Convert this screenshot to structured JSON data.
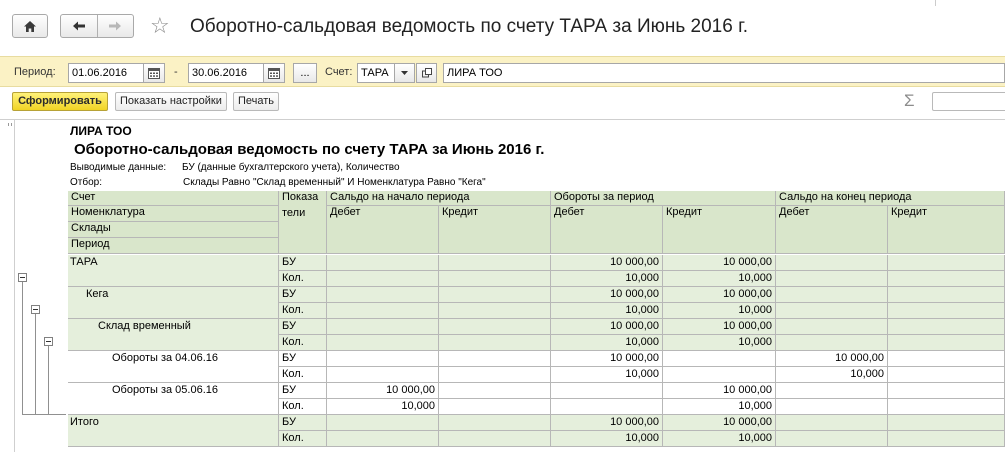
{
  "window": {
    "title": "Оборотно-сальдовая ведомость по счету ТАРА  за Июнь 2016 г."
  },
  "params": {
    "period_label": "Период:",
    "date_from": "01.06.2016",
    "dash": "-",
    "date_to": "30.06.2016",
    "more_button": "...",
    "account_label": "Счет:",
    "account_value": "ТАРА",
    "org_value": "ЛИРА ТОО"
  },
  "commands": {
    "generate": "Сформировать",
    "show_settings": "Показать настройки",
    "print": "Печать",
    "sigma": "Σ"
  },
  "report": {
    "org": "ЛИРА ТОО",
    "title": "Оборотно-сальдовая ведомость по счету ТАРА  за Июнь 2016 г.",
    "output_label": "Выводимые данные:",
    "output_value": "БУ (данные бухгалтерского учета), Количество",
    "filter_label": "Отбор:",
    "filter_value": "Склады Равно \"Склад временный\" И Номенклатура Равно \"Кега\"",
    "headers": {
      "account": "Счет",
      "nomenclature": "Номенклатура",
      "warehouses": "Склады",
      "period": "Период",
      "indicators_1": "Показа",
      "indicators_2": "тели",
      "opening": "Сальдо на начало периода",
      "turnover": "Обороты за период",
      "closing": "Сальдо на конец периода",
      "debit": "Дебет",
      "credit": "Кредит"
    },
    "rows": [
      {
        "label": "ТАРА",
        "bu": "БУ",
        "kol": "Кол.",
        "bu_vals": [
          "",
          "",
          "10 000,00",
          "10 000,00",
          "",
          ""
        ],
        "kol_vals": [
          "",
          "",
          "10,000",
          "10,000",
          "",
          ""
        ]
      },
      {
        "label": "Кега",
        "bu": "БУ",
        "kol": "Кол.",
        "bu_vals": [
          "",
          "",
          "10 000,00",
          "10 000,00",
          "",
          ""
        ],
        "kol_vals": [
          "",
          "",
          "10,000",
          "10,000",
          "",
          ""
        ]
      },
      {
        "label": "Склад временный",
        "bu": "БУ",
        "kol": "Кол.",
        "bu_vals": [
          "",
          "",
          "10 000,00",
          "10 000,00",
          "",
          ""
        ],
        "kol_vals": [
          "",
          "",
          "10,000",
          "10,000",
          "",
          ""
        ]
      },
      {
        "label": "Обороты за 04.06.16",
        "bu": "БУ",
        "kol": "Кол.",
        "bu_vals": [
          "",
          "",
          "10 000,00",
          "",
          "10 000,00",
          ""
        ],
        "kol_vals": [
          "",
          "",
          "10,000",
          "",
          "10,000",
          ""
        ]
      },
      {
        "label": "Обороты за 05.06.16",
        "bu": "БУ",
        "kol": "Кол.",
        "bu_vals": [
          "10 000,00",
          "",
          "",
          "10 000,00",
          "",
          ""
        ],
        "kol_vals": [
          "10,000",
          "",
          "",
          "10,000",
          "",
          ""
        ]
      },
      {
        "label": "Итого",
        "bu": "БУ",
        "kol": "Кол.",
        "bu_vals": [
          "",
          "",
          "10 000,00",
          "10 000,00",
          "",
          ""
        ],
        "kol_vals": [
          "",
          "",
          "10,000",
          "10,000",
          "",
          ""
        ]
      }
    ]
  },
  "colors": {
    "param_bar": "#fbf2c5",
    "header_fill": "#d9e6cb",
    "group_fill": "#e5efdc",
    "generate_button": "#f1d325"
  }
}
